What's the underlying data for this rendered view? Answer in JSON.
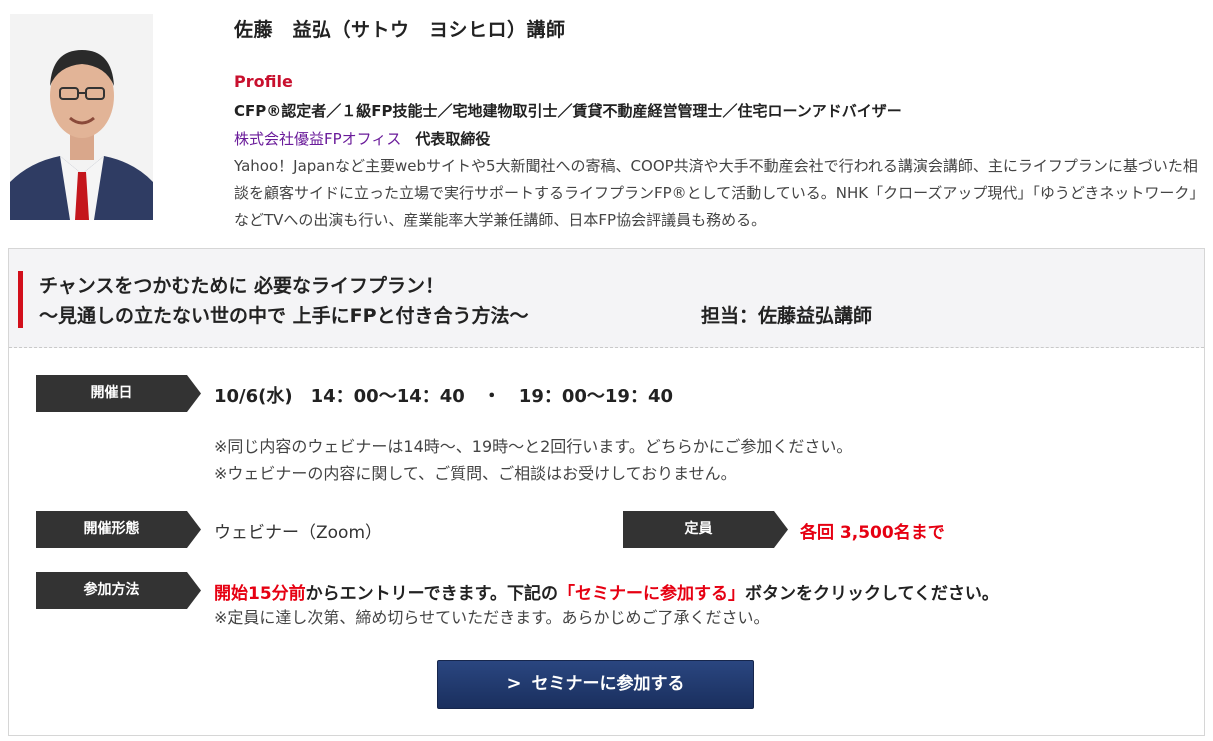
{
  "profile": {
    "name": "佐藤　益弘（サトウ　ヨシヒロ）講師",
    "section_label": "Profile",
    "qualifications": "CFP®認定者／１級FP技能士／宅地建物取引士／賃貸不動産経営管理士／住宅ローンアドバイザー",
    "company_link": "株式会社優益FPオフィス",
    "role": "代表取締役",
    "bio": "Yahoo！Japanなど主要webサイトや5大新聞社への寄稿、COOP共済や大手不動産会社で行われる講演会講師、主にライフプランに基づいた相談を顧客サイドに立った立場で実行サポートするライフプランFP®として活動している。NHK「クローズアップ現代」「ゆうどきネットワーク」などTVへの出演も行い、産業能率大学兼任講師、日本FP協会評議員も務める。"
  },
  "seminar": {
    "title_line1": "チャンスをつかむために 必要なライフプラン！",
    "title_line2": "〜見通しの立たない世の中で 上手にFPと付き合う方法〜",
    "tutor": "担当：佐藤益弘講師",
    "date_label": "開催日",
    "date_value": "10/6(水)　14：00〜14：40　・　19：00〜19：40",
    "note1": "※同じ内容のウェビナーは14時〜、19時〜と2回行います。どちらかにご参加ください。",
    "note2": "※ウェビナーの内容に関して、ご質問、ご相談はお受けしておりません。",
    "format_label": "開催形態",
    "format_value": "ウェビナー（Zoom）",
    "capacity_label": "定員",
    "capacity_value": "各回 3,500名まで",
    "join_label": "参加方法",
    "join_text_red1": "開始15分前",
    "join_text_mid": "からエントリーできます。下記の",
    "join_text_red2": "「セミナーに参加する」",
    "join_text_end": "ボタンをクリックしてください。",
    "join_note": "※定員に達し次第、締め切らせていただきます。あらかじめご了承ください。",
    "button_label": "セミナーに参加する",
    "button_icon": "chevron-right-icon"
  },
  "colors": {
    "accent_red": "#e60012",
    "tag_bg": "#333333",
    "button_bg": "#1f3769",
    "link_purple": "#6a1b9a"
  }
}
